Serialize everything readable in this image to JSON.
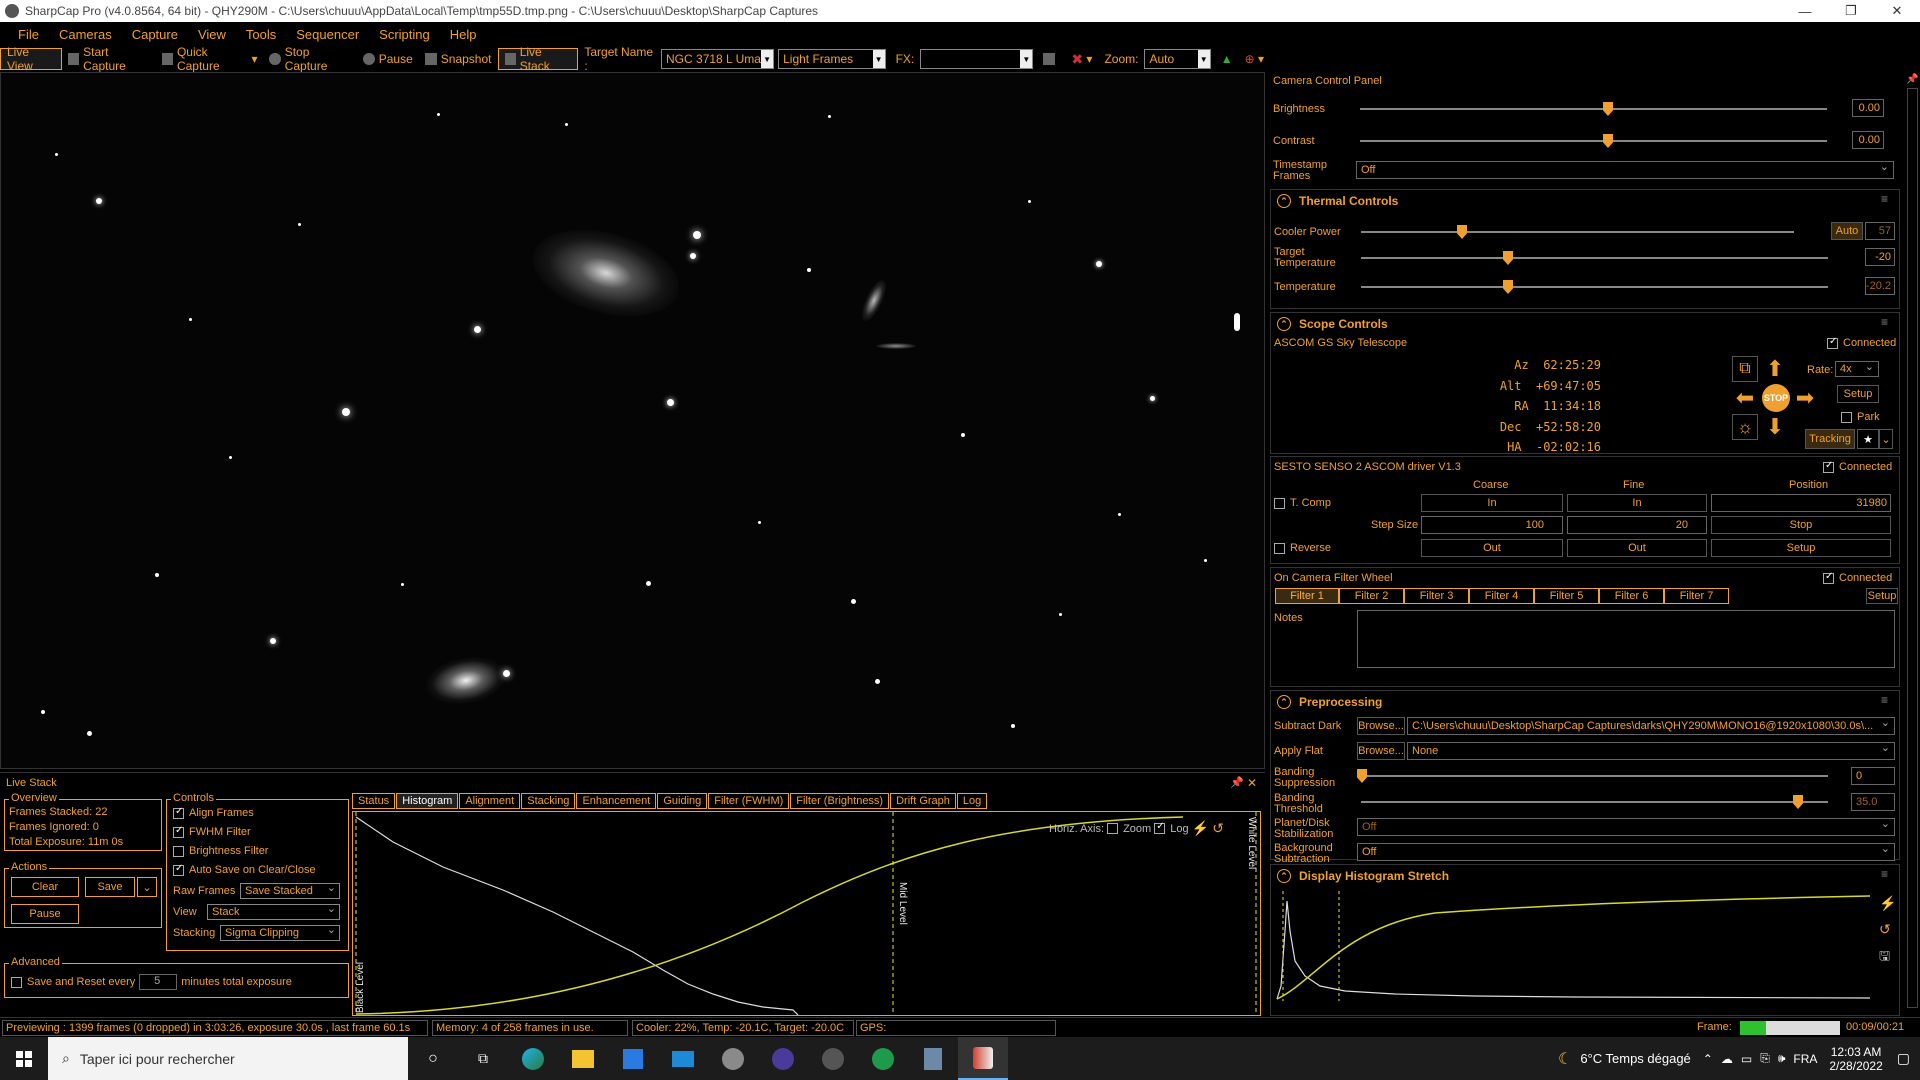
{
  "window": {
    "title": "SharpCap Pro (v4.0.8564, 64 bit) - QHY290M - C:\\Users\\chuuu\\AppData\\Local\\Temp\\tmp55D.tmp.png - C:\\Users\\chuuu\\Desktop\\SharpCap Captures",
    "minimize": "—",
    "maximize": "❐",
    "close": "✕"
  },
  "menu": [
    "File",
    "Cameras",
    "Capture",
    "View",
    "Tools",
    "Sequencer",
    "Scripting",
    "Help"
  ],
  "toolbar": {
    "live_view": "Live View",
    "start_capture": "Start Capture",
    "quick_capture": "Quick Capture",
    "stop_capture": "Stop Capture",
    "pause": "Pause",
    "snapshot": "Snapshot",
    "live_stack": "Live Stack",
    "target_name_label": "Target Name :",
    "target_name_value": "NGC 3718 L Uma",
    "frame_type": "Light Frames",
    "fx_label": "FX:",
    "fx_value": "",
    "zoom_label": "Zoom:",
    "zoom_value": "Auto"
  },
  "livestack": {
    "title": "Live Stack",
    "overview": {
      "title": "Overview",
      "frames_stacked_label": "Frames Stacked:",
      "frames_stacked": "22",
      "frames_ignored_label": "Frames Ignored:",
      "frames_ignored": "0",
      "total_exposure_label": "Total Exposure:",
      "total_exposure": "11m 0s"
    },
    "actions": {
      "title": "Actions",
      "clear": "Clear",
      "save": "Save",
      "pause": "Pause"
    },
    "advanced": {
      "title": "Advanced",
      "save_reset_label": "Save and Reset every",
      "save_reset_value": "5",
      "minutes_label": "minutes total exposure"
    },
    "controls": {
      "title": "Controls",
      "align_frames": "Align Frames",
      "fwhm_filter": "FWHM Filter",
      "brightness_filter": "Brightness Filter",
      "auto_save": "Auto Save on Clear/Close",
      "raw_frames_label": "Raw Frames",
      "raw_frames_value": "Save Stacked",
      "view_label": "View",
      "view_value": "Stack",
      "stacking_label": "Stacking",
      "stacking_value": "Sigma Clipping"
    },
    "tabs": [
      "Status",
      "Histogram",
      "Alignment",
      "Stacking",
      "Enhancement",
      "Guiding",
      "Filter (FWHM)",
      "Filter (Brightness)",
      "Drift Graph",
      "Log"
    ],
    "histogram": {
      "horiz_axis_label": "Horiz. Axis:",
      "zoom_label": "Zoom",
      "log_label": "Log",
      "black_level": "Black Level",
      "mid_level": "Mid Level",
      "white_level": "White Level"
    },
    "pin": "📌",
    "close": "✕"
  },
  "camera_panel": {
    "title": "Camera Control Panel",
    "brightness_label": "Brightness",
    "brightness_value": "0.00",
    "contrast_label": "Contrast",
    "contrast_value": "0.00",
    "timestamp_label_1": "Timestamp",
    "timestamp_label_2": "Frames",
    "timestamp_value": "Off",
    "thermal": {
      "title": "Thermal Controls",
      "cooler_power_label": "Cooler Power",
      "cooler_auto": "Auto",
      "cooler_value": "57",
      "target_temp_label_1": "Target",
      "target_temp_label_2": "Temperature",
      "target_temp_value": "-20",
      "temperature_label": "Temperature",
      "temperature_value": "-20.2"
    },
    "scope": {
      "title": "Scope Controls",
      "telescope": "ASCOM GS Sky Telescope",
      "connected": "Connected",
      "az_label": "Az",
      "az": "62:25:29",
      "alt_label": "Alt",
      "alt": "+69:47:05",
      "ra_label": "RA",
      "ra": "11:34:18",
      "dec_label": "Dec",
      "dec": "+52:58:20",
      "ha_label": "HA",
      "ha": "-02:02:16",
      "rate_label": "Rate:",
      "rate_value": "4x",
      "setup": "Setup",
      "park": "Park",
      "stop": "STOP",
      "tracking": "Tracking"
    },
    "focuser": {
      "title": "SESTO SENSO 2 ASCOM driver V1.3",
      "connected": "Connected",
      "coarse": "Coarse",
      "fine": "Fine",
      "position": "Position",
      "t_comp": "T. Comp",
      "in": "In",
      "position_value": "31980",
      "step_size_label": "Step Size",
      "coarse_step": "100",
      "fine_step": "20",
      "stop": "Stop",
      "reverse": "Reverse",
      "out": "Out",
      "setup": "Setup"
    },
    "filterwheel": {
      "title": "On Camera Filter Wheel",
      "connected": "Connected",
      "filters": [
        "Filter 1",
        "Filter 2",
        "Filter 3",
        "Filter 4",
        "Filter 5",
        "Filter 6",
        "Filter 7"
      ],
      "setup": "Setup"
    },
    "notes_label": "Notes",
    "preprocessing": {
      "title": "Preprocessing",
      "subtract_dark_label": "Subtract Dark",
      "browse": "Browse...",
      "dark_value": "C:\\Users\\chuuu\\Desktop\\SharpCap Captures\\darks\\QHY290M\\MONO16@1920x1080\\30.0s\\...",
      "apply_flat_label": "Apply Flat",
      "flat_value": "None",
      "banding_supp_label_1": "Banding",
      "banding_supp_label_2": "Suppression",
      "banding_supp_value": "0",
      "banding_thr_label_1": "Banding",
      "banding_thr_label_2": "Threshold",
      "banding_thr_value": "35.0",
      "planet_label_1": "Planet/Disk",
      "planet_label_2": "Stabilization",
      "planet_value": "Off",
      "bg_label_1": "Background",
      "bg_label_2": "Subtraction",
      "bg_value": "Off"
    },
    "histogram_stretch": {
      "title": "Display Histogram Stretch"
    }
  },
  "statusbar": {
    "preview": "Previewing : 1399 frames (0 dropped) in 3:03:26, exposure 30.0s , last frame 60.1s",
    "memory": "Memory: 4 of 258 frames in use.",
    "cooler": "Cooler: 22%, Temp: -20.1C, Target: -20.0C",
    "gps": "GPS:",
    "frame_label": "Frame:",
    "frame_time": "00:09/00:21"
  },
  "taskbar": {
    "search_placeholder": "Taper ici pour rechercher",
    "weather": "6°C  Temps dégagé",
    "lang": "FRA",
    "time": "12:03 AM",
    "date": "2/28/2022"
  }
}
